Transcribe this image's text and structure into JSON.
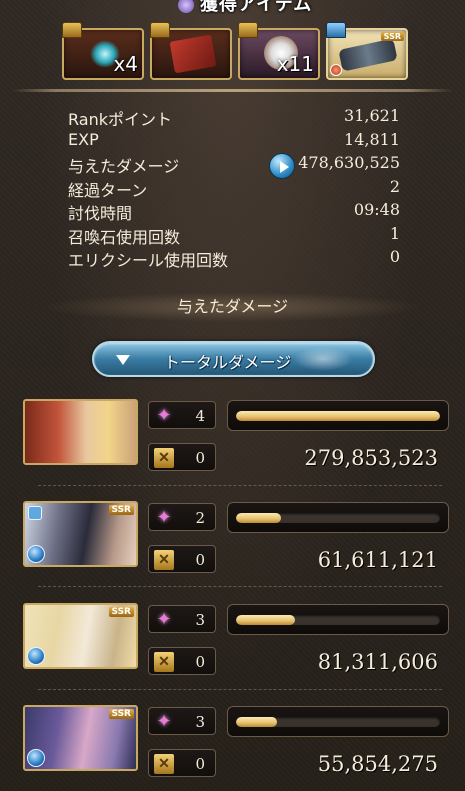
{
  "header": {
    "title": "獲得アイテム"
  },
  "drops": [
    {
      "icon": "blue-flame-orb-icon",
      "quantity": "x4"
    },
    {
      "icon": "red-scroll-icon",
      "quantity": ""
    },
    {
      "icon": "white-orb-icon",
      "quantity": "x11"
    },
    {
      "icon": "ssr-weapon-icon",
      "quantity": "",
      "rarity": "SSR"
    }
  ],
  "stats": [
    {
      "label": "Rankポイント",
      "value": "31,621"
    },
    {
      "label": "EXP",
      "value": "14,811"
    },
    {
      "label": "与えたダメージ",
      "value": "478,630,525",
      "has_play_button": true
    },
    {
      "label": "経過ターン",
      "value": "2"
    },
    {
      "label": "討伐時間",
      "value": "09:48"
    },
    {
      "label": "召喚石使用回数",
      "value": "1"
    },
    {
      "label": "エリクシール使用回数",
      "value": "0"
    }
  ],
  "damage_section": {
    "title": "与えたダメージ"
  },
  "dropdown": {
    "label": "トータルダメージ"
  },
  "party": [
    {
      "portrait": "main-character-portrait",
      "rarity": "",
      "ca_count": "4",
      "skill_count": "0",
      "damage": "279,853,523",
      "bar_fraction": 1.0
    },
    {
      "portrait": "dark-haired-character-portrait",
      "rarity": "SSR",
      "ca_count": "2",
      "skill_count": "0",
      "damage": "61,611,121",
      "bar_fraction": 0.22
    },
    {
      "portrait": "eyepatch-character-portrait",
      "rarity": "SSR",
      "ca_count": "3",
      "skill_count": "0",
      "damage": "81,311,606",
      "bar_fraction": 0.29
    },
    {
      "portrait": "pink-haired-character-portrait",
      "rarity": "SSR",
      "ca_count": "3",
      "skill_count": "0",
      "damage": "55,854,275",
      "bar_fraction": 0.2
    }
  ]
}
